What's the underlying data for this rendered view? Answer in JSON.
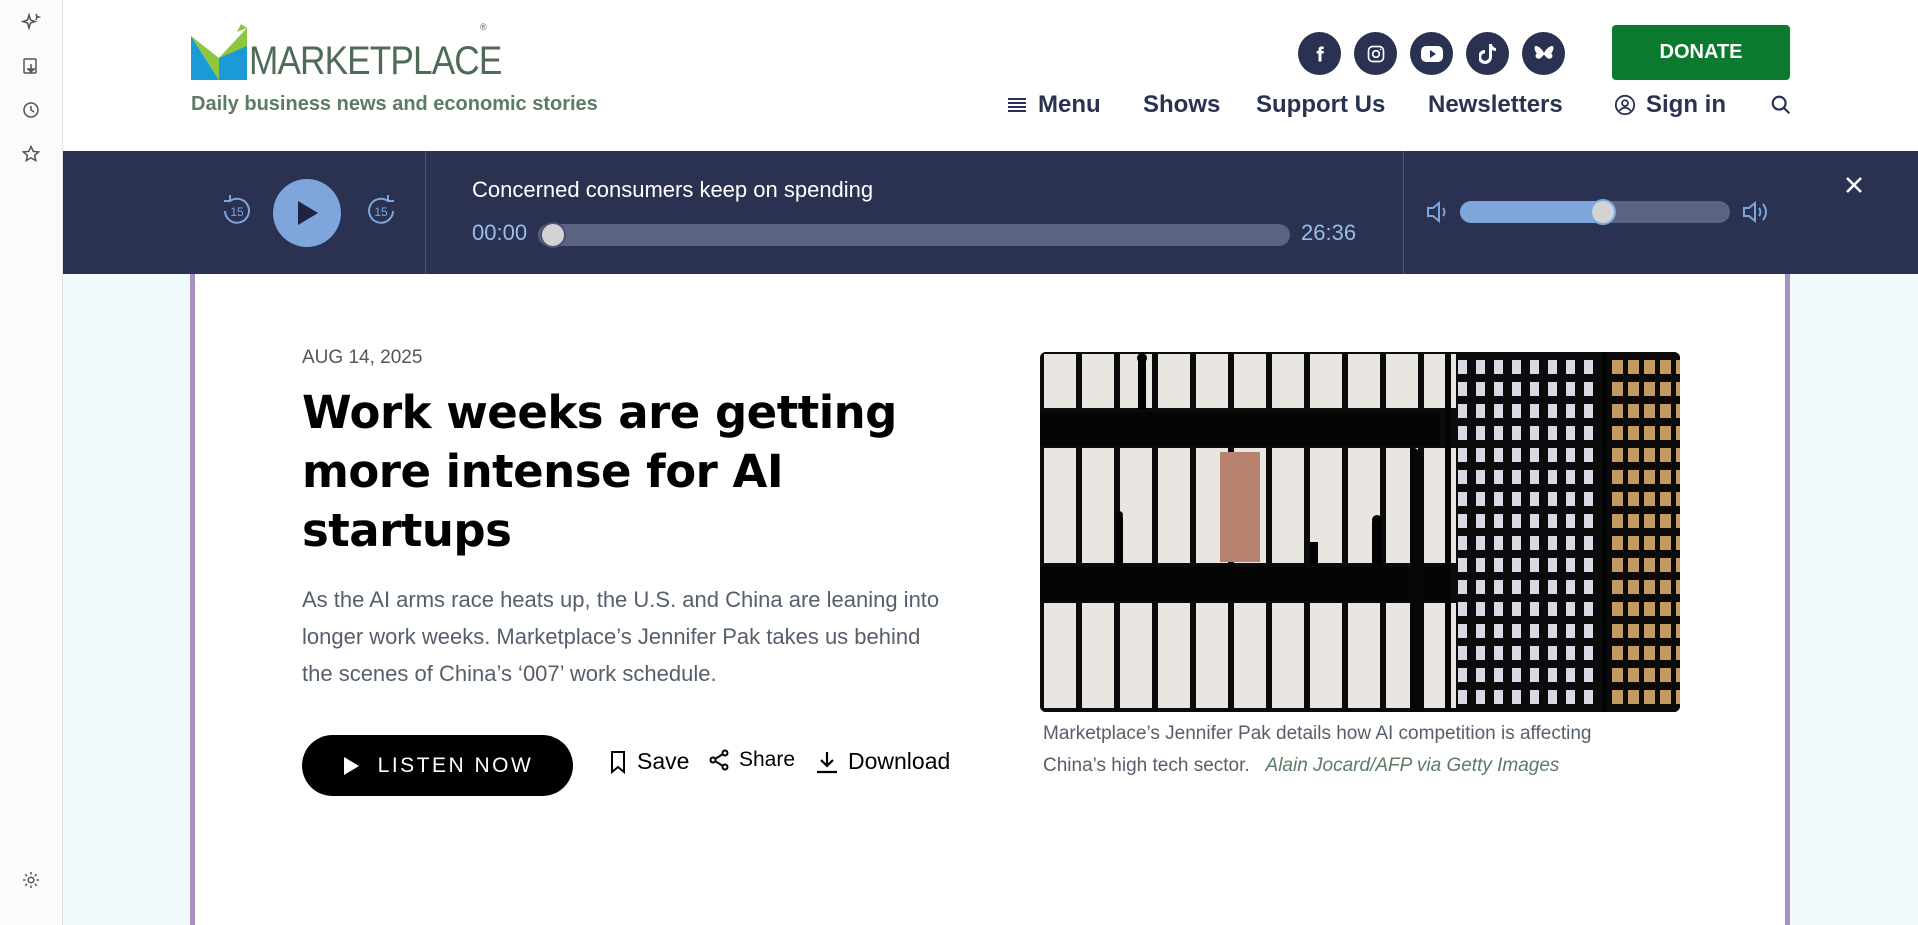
{
  "browser": {
    "rail_icons": [
      "sparkle-icon",
      "save-page-icon",
      "history-icon",
      "favorites-icon",
      "settings-icon"
    ]
  },
  "header": {
    "logo_text": "MARKETPLACE",
    "tagline": "Daily business news and economic stories",
    "socials": [
      "facebook-icon",
      "instagram-icon",
      "youtube-icon",
      "tiktok-icon",
      "bluesky-icon"
    ],
    "donate_label": "DONATE",
    "nav": {
      "menu": "Menu",
      "shows": "Shows",
      "support": "Support Us",
      "newsletters": "Newsletters",
      "signin": "Sign in"
    }
  },
  "player": {
    "title": "Concerned consumers keep on spending",
    "current_time": "00:00",
    "duration": "26:36",
    "rewind_label": "15",
    "forward_label": "15",
    "progress": 0.0,
    "volume": 0.5
  },
  "article": {
    "date": "AUG 14, 2025",
    "headline": "Work weeks are getting more intense for AI startups",
    "dek": "As the AI arms race heats up, the U.S. and China are leaning into longer work weeks. Marketplace’s Jennifer Pak takes us behind the scenes of China’s ‘007’ work schedule.",
    "listen_label": "LISTEN NOW",
    "save_label": "Save",
    "share_label": "Share",
    "download_label": "Download",
    "caption": "Marketplace’s Jennifer Pak details how AI competition is affecting China’s high tech sector.",
    "credit": "Alain Jocard/AFP via Getty Images"
  },
  "colors": {
    "navy": "#2b3150",
    "donate_green": "#0b7a2f",
    "player_accent": "#7ea6dd",
    "card_border": "#a990c6",
    "page_bg": "#f1fbfb"
  }
}
